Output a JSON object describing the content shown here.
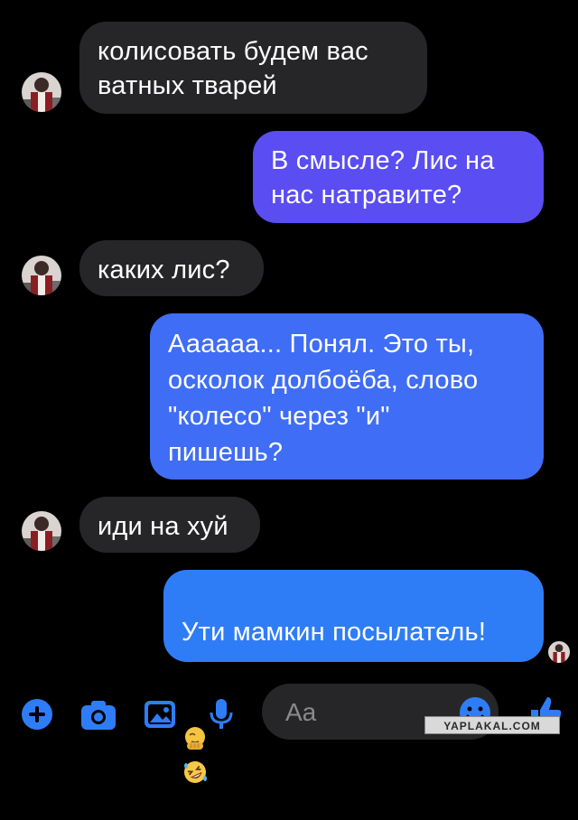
{
  "conversation": {
    "messages": [
      {
        "direction": "incoming",
        "text": "колисовать будем вас\nватных тварей"
      },
      {
        "direction": "outgoing",
        "text": "В смысле? Лис на\nнас натравите?"
      },
      {
        "direction": "incoming",
        "text": "каких лис?"
      },
      {
        "direction": "outgoing",
        "text": "Аааааа... Понял. Это ты,\nосколок долбоёба, слово\n\"колесо\" через \"и\"\nпишешь?"
      },
      {
        "direction": "incoming",
        "text": "иди на хуй"
      },
      {
        "direction": "outgoing",
        "text": "Ути мамкин посылатель!",
        "emojis": [
          "face-palm-emoji",
          "rolling-laughing-emoji"
        ]
      }
    ]
  },
  "composer": {
    "placeholder": "Aa"
  },
  "toolbar": {
    "icons": [
      "plus-icon",
      "camera-icon",
      "image-icon",
      "microphone-icon",
      "emoji-icon",
      "like-icon"
    ]
  },
  "colors": {
    "accent": "#2f7df6",
    "outgoing_top": "#5a4cf2",
    "outgoing_bottom": "#2f7df6",
    "incoming_bubble": "#262628",
    "background": "#000000"
  },
  "watermark": {
    "text": "YAPLAKAL.COM"
  }
}
